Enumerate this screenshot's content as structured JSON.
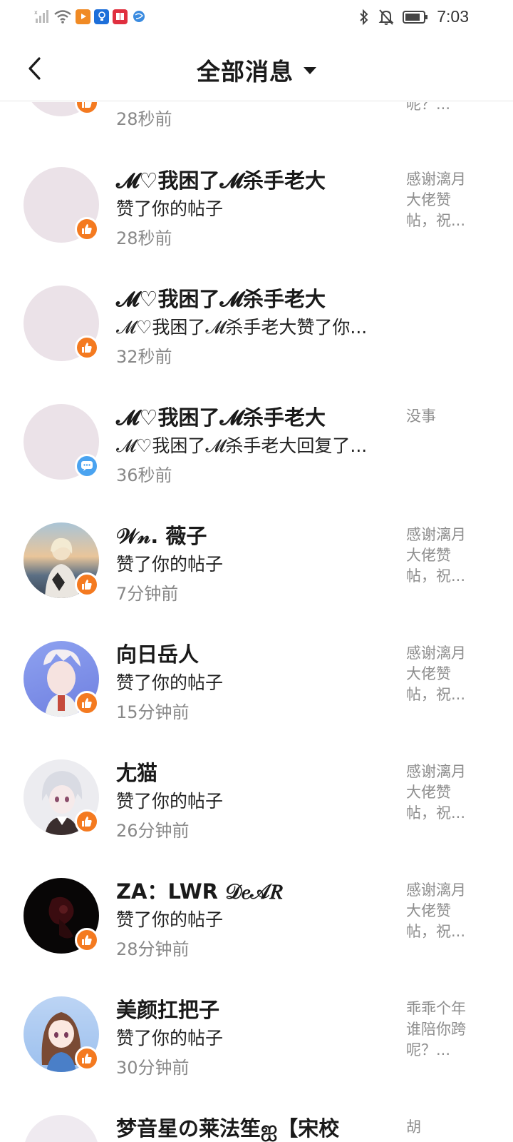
{
  "status_bar": {
    "time": "7:03"
  },
  "header": {
    "title": "全部消息"
  },
  "messages": [
    {
      "name": "",
      "desc": "",
      "time": "28秒前",
      "preview": "呢？...",
      "type": "like"
    },
    {
      "name": "𝓜♡我困了𝓜杀手老大",
      "desc": "赞了你的帖子",
      "time": "28秒前",
      "preview": "感谢漓月大佬赞帖，祝...",
      "type": "like"
    },
    {
      "name": "𝓜♡我困了𝓜杀手老大",
      "desc": "𝓜♡我困了𝓜杀手老大赞了你...",
      "time": "32秒前",
      "preview": "",
      "type": "like"
    },
    {
      "name": "𝓜♡我困了𝓜杀手老大",
      "desc": "𝓜♡我困了𝓜杀手老大回复了...",
      "time": "36秒前",
      "preview": "没事",
      "type": "comment"
    },
    {
      "name": "𝒲𝓃. 薇子",
      "desc": "赞了你的帖子",
      "time": "7分钟前",
      "preview": "感谢漓月大佬赞帖，祝...",
      "type": "like"
    },
    {
      "name": "向日岳人",
      "desc": "赞了你的帖子",
      "time": "15分钟前",
      "preview": "感谢漓月大佬赞帖，祝...",
      "type": "like"
    },
    {
      "name": "尢猫",
      "desc": "赞了你的帖子",
      "time": "26分钟前",
      "preview": "感谢漓月大佬赞帖，祝...",
      "type": "like"
    },
    {
      "name": "ZA：LWR 𝒟𝑒𝒜𝑅",
      "desc": "赞了你的帖子",
      "time": "28分钟前",
      "preview": "感谢漓月大佬赞帖，祝...",
      "type": "like"
    },
    {
      "name": "美颜扛把子",
      "desc": "赞了你的帖子",
      "time": "30分钟前",
      "preview": "乖乖个年谁陪你跨呢？...",
      "type": "like"
    },
    {
      "name": "梦音星の莱法笙ஐ【宋校",
      "desc": "",
      "time": "",
      "preview": "胡",
      "type": "like"
    }
  ],
  "colors": {
    "like_badge": "#f47a20",
    "comment_badge": "#4aa3f0",
    "avatar_placeholder": "#ebe2e8"
  }
}
